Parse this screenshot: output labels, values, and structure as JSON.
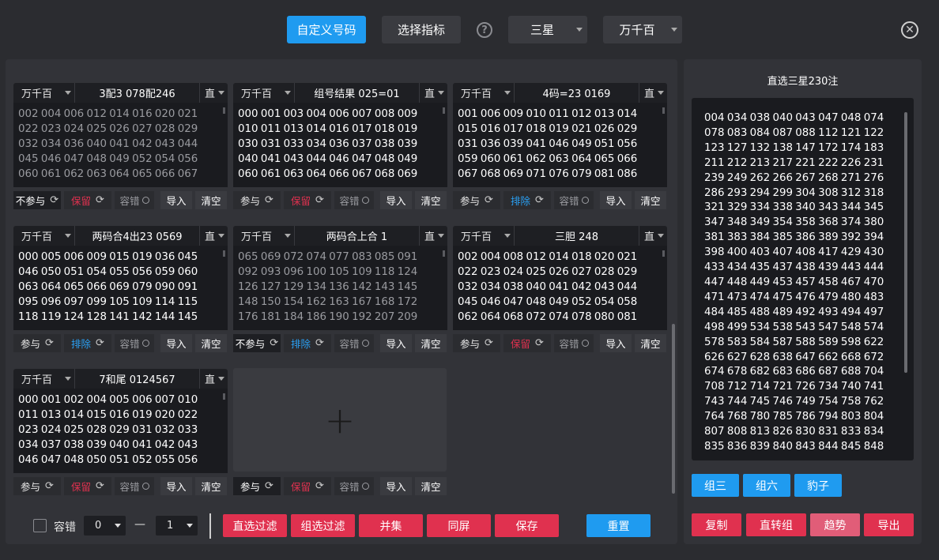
{
  "topbar": {
    "custom_btn": "自定义号码",
    "select_btn": "选择指标",
    "dd1": "三星",
    "dd2": "万千百"
  },
  "cards": [
    {
      "pos": "万千百",
      "title": "3配3 078配246",
      "mode": "直",
      "style": "dim",
      "numbers": "002 004 006 012 014 016 020 021 022 023 024 025 026 027 028 029 032 034 036 040 041 042 043 044 045 046 047 048 049 052 054 056 060 061 062 063 064 065 066 067",
      "b1": "不参与",
      "b2": "保留",
      "b3": "容错",
      "imp": "导入",
      "clr": "清空"
    },
    {
      "pos": "万千百",
      "title": "组号结果 025=01",
      "mode": "直",
      "style": "bright",
      "numbers": "000 001 003 004 006 007 008 009 010 011 013 014 016 017 018 019 030 031 033 034 036 037 038 039 040 041 043 044 046 047 048 049 060 061 063 064 066 067 068 069",
      "b1": "参与",
      "b2": "保留",
      "b3": "容错",
      "imp": "导入",
      "clr": "清空"
    },
    {
      "pos": "万千百",
      "title": "4码=23 0169",
      "mode": "直",
      "style": "bright",
      "numbers": "001 006 009 010 011 012 013 014 015 016 017 018 019 021 026 029 031 036 039 041 046 049 051 056 059 060 061 062 063 064 065 066 067 068 069 071 076 079 081 086",
      "b1": "参与",
      "b2": "排除",
      "b3": "容错",
      "imp": "导入",
      "clr": "清空"
    },
    {
      "pos": "万千百",
      "title": "两码合4出23 0569",
      "mode": "直",
      "style": "bright",
      "numbers": "000 005 006 009 015 019 036 045 046 050 051 054 055 056 059 060 063 064 065 066 069 079 090 091 095 096 097 099 105 109 114 115 118 119 124 128 141 142 144 145",
      "b1": "参与",
      "b2": "排除",
      "b3": "容错",
      "imp": "导入",
      "clr": "清空"
    },
    {
      "pos": "万千百",
      "title": "两码合上合 1",
      "mode": "直",
      "style": "dim",
      "numbers": "065 069 072 074 077 083 085 091 092 093 096 100 105 109 118 124 126 127 129 134 136 142 143 145 148 150 154 162 163 167 168 172 176 181 184 186 190 192 207 209",
      "b1": "不参与",
      "b2": "排除",
      "b3": "容错",
      "imp": "导入",
      "clr": "清空"
    },
    {
      "pos": "万千百",
      "title": "三胆 248",
      "mode": "直",
      "style": "bright",
      "numbers": "002 004 008 012 014 018 020 021 022 023 024 025 026 027 028 029 032 034 038 040 041 042 043 044 045 046 047 048 049 052 054 058 062 064 068 072 074 078 080 081",
      "b1": "参与",
      "b2": "保留",
      "b3": "容错",
      "imp": "导入",
      "clr": "清空"
    },
    {
      "pos": "万千百",
      "title": "7和尾 0124567",
      "mode": "直",
      "style": "bright",
      "numbers": "000 001 002 004 005 006 007 010 011 013 014 015 016 019 020 022 023 024 025 028 029 031 032 033 034 037 038 039 040 041 042 043 046 047 048 050 051 052 055 056",
      "b1": "参与",
      "b2": "保留",
      "b3": "容错",
      "imp": "导入",
      "clr": "清空"
    }
  ],
  "extra_ctrl": {
    "b1": "参与",
    "b2": "保留",
    "b3": "容错",
    "imp": "导入",
    "clr": "清空"
  },
  "bottom": {
    "chk_label": "容错",
    "dd_from": "0",
    "dash": "—",
    "dd_to": "1",
    "btns": [
      "直选过滤",
      "组选过滤",
      "并集",
      "同屏",
      "保存"
    ],
    "reset": "重置"
  },
  "right": {
    "title": "直选三星230注",
    "numbers": "004 034 038 040 043 047 048 074 078 083 084 087 088 112 121 122 123 127 132 138 147 172 174 183 211 212 213 217 221 222 226 231 239 249 262 266 267 268 271 276 286 293 294 299 304 308 312 318 321 329 334 338 340 343 344 345 347 348 349 354 358 368 374 380 381 383 384 385 386 389 392 394 398 400 403 407 408 417 429 430 433 434 435 437 438 439 443 444 447 448 449 453 457 458 467 470 471 473 474 475 476 479 480 483 484 485 488 489 492 493 494 497 498 499 534 538 543 547 548 574 578 583 584 587 588 589 598 622 626 627 628 638 647 662 668 672 674 678 682 683 686 687 688 704 708 712 714 721 726 734 740 741 743 744 745 746 749 754 758 762 764 768 780 785 786 794 803 804 807 808 813 826 830 831 833 834 835 836 839 840 843 844 845 848",
    "group_btns": [
      "组三",
      "组六",
      "豹子"
    ],
    "action_btns": [
      "复制",
      "直转组",
      "趋势",
      "导出"
    ]
  }
}
